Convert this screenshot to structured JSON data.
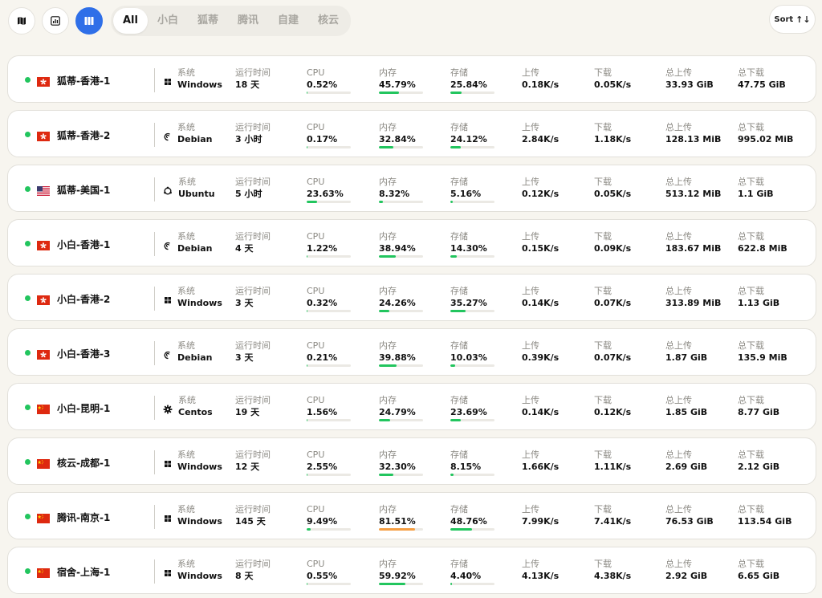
{
  "toolbar": {
    "tabs": [
      "All",
      "小白",
      "狐蒂",
      "腾讯",
      "自建",
      "核云"
    ],
    "sort_label": "Sort",
    "sort_icon": "↑↓"
  },
  "labels": {
    "os": "系统",
    "uptime": "运行时间",
    "cpu": "CPU",
    "mem": "内存",
    "disk": "存储",
    "up": "上传",
    "down": "下载",
    "total_up": "总上传",
    "total_down": "总下载"
  },
  "servers": [
    {
      "name": "狐蒂-香港-1",
      "flag": "hk",
      "os": "Windows",
      "uptime": "18 天",
      "cpu": "0.52%",
      "cpu_pct": 0.52,
      "mem": "45.79%",
      "mem_pct": 45.79,
      "disk": "25.84%",
      "disk_pct": 25.84,
      "up": "0.18K/s",
      "down": "0.05K/s",
      "total_up": "33.93 GiB",
      "total_down": "47.75 GiB"
    },
    {
      "name": "狐蒂-香港-2",
      "flag": "hk",
      "os": "Debian",
      "uptime": "3 小时",
      "cpu": "0.17%",
      "cpu_pct": 0.17,
      "mem": "32.84%",
      "mem_pct": 32.84,
      "disk": "24.12%",
      "disk_pct": 24.12,
      "up": "2.84K/s",
      "down": "1.18K/s",
      "total_up": "128.13 MiB",
      "total_down": "995.02 MiB"
    },
    {
      "name": "狐蒂-美国-1",
      "flag": "us",
      "os": "Ubuntu",
      "uptime": "5 小时",
      "cpu": "23.63%",
      "cpu_pct": 23.63,
      "mem": "8.32%",
      "mem_pct": 8.32,
      "disk": "5.16%",
      "disk_pct": 5.16,
      "up": "0.12K/s",
      "down": "0.05K/s",
      "total_up": "513.12 MiB",
      "total_down": "1.1 GiB"
    },
    {
      "name": "小白-香港-1",
      "flag": "hk",
      "os": "Debian",
      "uptime": "4 天",
      "cpu": "1.22%",
      "cpu_pct": 1.22,
      "mem": "38.94%",
      "mem_pct": 38.94,
      "disk": "14.30%",
      "disk_pct": 14.3,
      "up": "0.15K/s",
      "down": "0.09K/s",
      "total_up": "183.67 MiB",
      "total_down": "622.8 MiB"
    },
    {
      "name": "小白-香港-2",
      "flag": "hk",
      "os": "Windows",
      "uptime": "3 天",
      "cpu": "0.32%",
      "cpu_pct": 0.32,
      "mem": "24.26%",
      "mem_pct": 24.26,
      "disk": "35.27%",
      "disk_pct": 35.27,
      "up": "0.14K/s",
      "down": "0.07K/s",
      "total_up": "313.89 MiB",
      "total_down": "1.13 GiB"
    },
    {
      "name": "小白-香港-3",
      "flag": "hk",
      "os": "Debian",
      "uptime": "3 天",
      "cpu": "0.21%",
      "cpu_pct": 0.21,
      "mem": "39.88%",
      "mem_pct": 39.88,
      "disk": "10.03%",
      "disk_pct": 10.03,
      "up": "0.39K/s",
      "down": "0.07K/s",
      "total_up": "1.87 GiB",
      "total_down": "135.9 MiB"
    },
    {
      "name": "小白-昆明-1",
      "flag": "cn",
      "os": "Centos",
      "uptime": "19 天",
      "cpu": "1.56%",
      "cpu_pct": 1.56,
      "mem": "24.79%",
      "mem_pct": 24.79,
      "disk": "23.69%",
      "disk_pct": 23.69,
      "up": "0.14K/s",
      "down": "0.12K/s",
      "total_up": "1.85 GiB",
      "total_down": "8.77 GiB"
    },
    {
      "name": "核云-成都-1",
      "flag": "cn",
      "os": "Windows",
      "uptime": "12 天",
      "cpu": "2.55%",
      "cpu_pct": 2.55,
      "mem": "32.30%",
      "mem_pct": 32.3,
      "disk": "8.15%",
      "disk_pct": 8.15,
      "up": "1.66K/s",
      "down": "1.11K/s",
      "total_up": "2.69 GiB",
      "total_down": "2.12 GiB"
    },
    {
      "name": "腾讯-南京-1",
      "flag": "cn",
      "os": "Windows",
      "uptime": "145 天",
      "cpu": "9.49%",
      "cpu_pct": 9.49,
      "mem": "81.51%",
      "mem_pct": 81.51,
      "disk": "48.76%",
      "disk_pct": 48.76,
      "up": "7.99K/s",
      "down": "7.41K/s",
      "total_up": "76.53 GiB",
      "total_down": "113.54 GiB"
    },
    {
      "name": "宿舍-上海-1",
      "flag": "cn",
      "os": "Windows",
      "uptime": "8 天",
      "cpu": "0.55%",
      "cpu_pct": 0.55,
      "mem": "59.92%",
      "mem_pct": 59.92,
      "disk": "4.40%",
      "disk_pct": 4.4,
      "up": "4.13K/s",
      "down": "4.38K/s",
      "total_up": "2.92 GiB",
      "total_down": "6.65 GiB"
    }
  ],
  "colors": {
    "accent": "#2f6fe8",
    "online": "#22c55e",
    "bar_ok": "#22c55e",
    "bar_warn": "#f59e42"
  }
}
